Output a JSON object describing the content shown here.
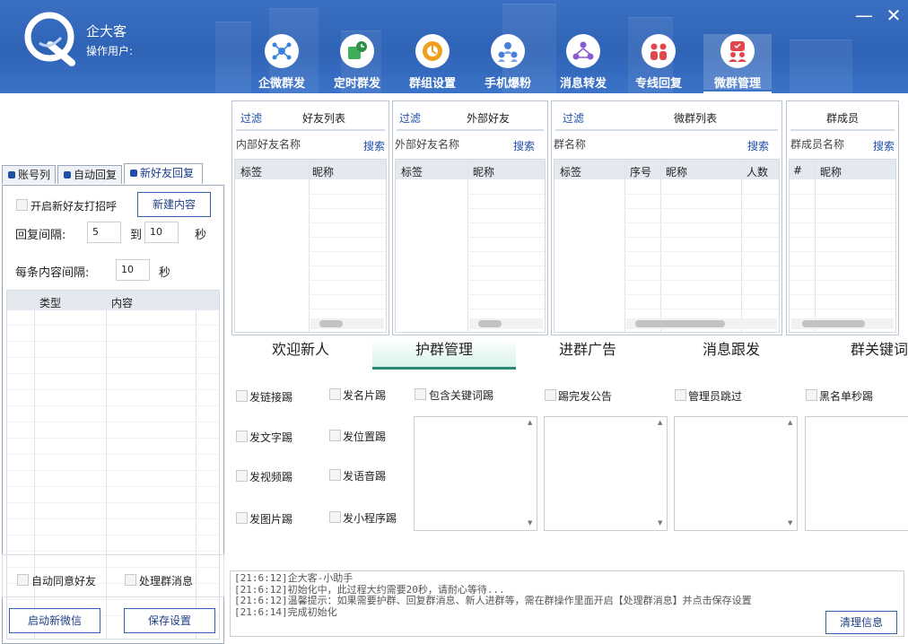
{
  "app": {
    "name": "企大客",
    "operator_label": "操作用户:"
  },
  "window": {
    "minimize": "—",
    "close": "✕"
  },
  "nav": [
    {
      "label": "企微群发",
      "icon": "share-network-icon"
    },
    {
      "label": "定时群发",
      "icon": "scheduled-send-icon"
    },
    {
      "label": "群组设置",
      "icon": "group-settings-icon"
    },
    {
      "label": "手机爆粉",
      "icon": "phone-fans-icon"
    },
    {
      "label": "消息转发",
      "icon": "message-forward-icon"
    },
    {
      "label": "专线回复",
      "icon": "dedicated-reply-icon"
    },
    {
      "label": "微群管理",
      "icon": "wechat-group-manage-icon"
    }
  ],
  "left_tabs": [
    {
      "label": "账号列"
    },
    {
      "label": "自动回复"
    },
    {
      "label": "新好友回复"
    }
  ],
  "left": {
    "greet_checkbox_label": "开启新好友打招呼",
    "new_content_button": "新建内容",
    "reply_interval_label": "回复间隔:",
    "reply_interval_from": "5",
    "to_label": "到",
    "reply_interval_to": "10",
    "seconds_label": "秒",
    "content_interval_label": "每条内容间隔:",
    "content_interval_value": "10",
    "content_seconds_label": "秒",
    "table_headers": [
      "类型",
      "内容"
    ],
    "auto_accept_label": "自动同意好友",
    "process_group_msg_label": "处理群消息",
    "start_wechat_button": "启动新微信",
    "save_settings_button": "保存设置"
  },
  "panels": {
    "friends": {
      "filter": "过滤",
      "title": "好友列表",
      "search_label": "内部好友名称",
      "search": "搜索",
      "headers": [
        "标签",
        "昵称"
      ]
    },
    "external": {
      "filter": "过滤",
      "title": "外部好友",
      "search_label": "外部好友名称",
      "search": "搜索",
      "headers": [
        "标签",
        "昵称"
      ]
    },
    "groups": {
      "filter": "过滤",
      "title": "微群列表",
      "search_label": "群名称",
      "search": "搜索",
      "headers": [
        "标签",
        "序号",
        "昵称",
        "人数"
      ]
    },
    "members": {
      "title": "群成员",
      "search_label": "群成员名称",
      "search": "搜索",
      "headers": [
        "#",
        "昵称"
      ]
    }
  },
  "bottom_tabs": [
    {
      "label": "欢迎新人"
    },
    {
      "label": "护群管理"
    },
    {
      "label": "进群广告"
    },
    {
      "label": "消息跟发"
    },
    {
      "label": "群关键词"
    }
  ],
  "guard": {
    "kick_link": "发链接踢",
    "kick_card": "发名片踢",
    "kick_text": "发文字踢",
    "kick_location": "发位置踢",
    "kick_video": "发视频踢",
    "kick_voice": "发语音踢",
    "kick_image": "发图片踢",
    "kick_miniprogram": "发小程序踢",
    "keyword_kick": "包含关键词踢",
    "kick_after_notice": "踢完发公告",
    "admin_skip": "管理员跳过",
    "blacklist_kick": "黑名单秒踢"
  },
  "log": {
    "lines": [
      "[21:6:12]企大客-小助手",
      "[21:6:12]初始化中，此过程大约需要20秒，请耐心等待...",
      "[21:6:12]温馨提示：如果需要护群、回复群消息、新人进群等，需在群操作里面开启【处理群消息】并点击保存设置",
      "[21:6:14]完成初始化"
    ],
    "clear_button": "清理信息"
  }
}
